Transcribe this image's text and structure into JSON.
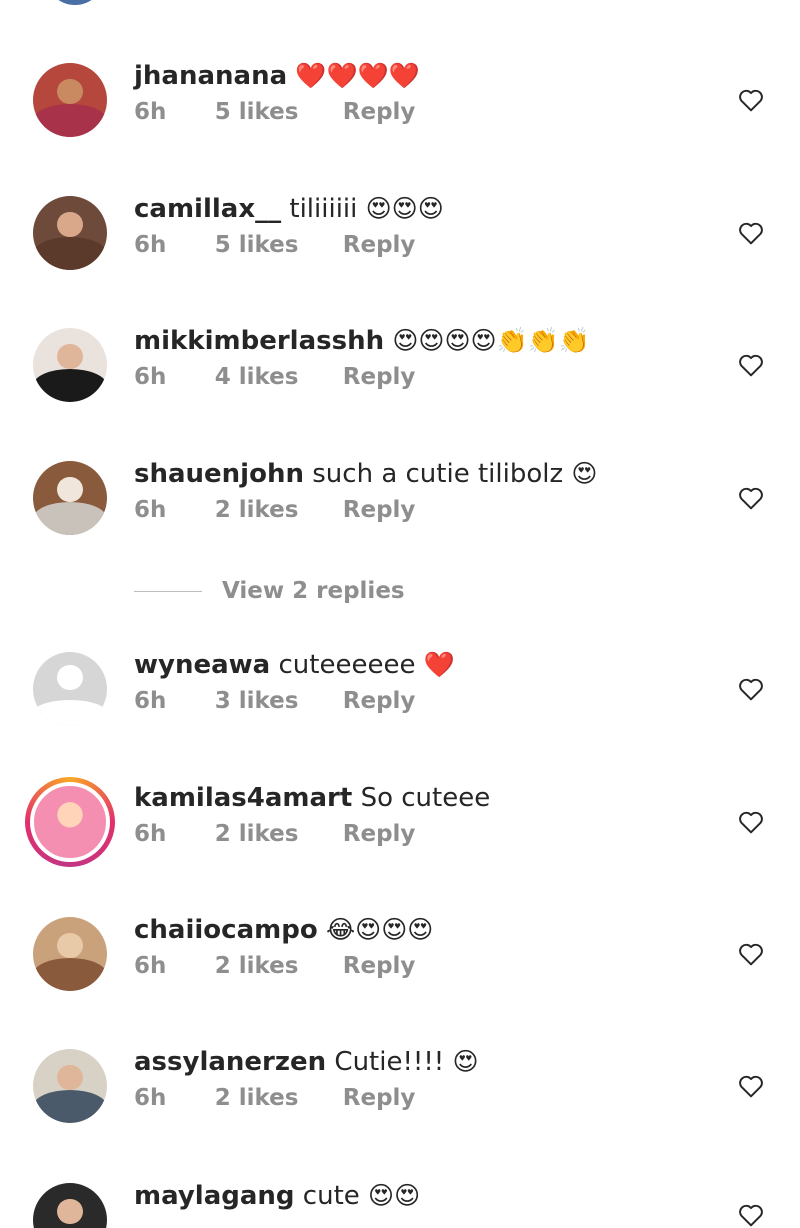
{
  "comments": [
    {
      "username": "jhananana",
      "text": "",
      "emoji": "❤️❤️❤️❤️",
      "time": "6h",
      "likes": "5 likes",
      "reply": "Reply",
      "avatar": {
        "bg": "#b5473c",
        "skin": "#c98a62",
        "shirt": "#a8324a"
      }
    },
    {
      "username": "camillax__",
      "text": "tiliiiiii",
      "emoji": "😍😍😍",
      "time": "6h",
      "likes": "5 likes",
      "reply": "Reply",
      "avatar": {
        "bg": "#6e4a3a",
        "skin": "#d9a88a",
        "shirt": "#5b3a2c"
      }
    },
    {
      "username": "mikkimberlasshh",
      "text": "",
      "emoji": "😍😍😍😍👏👏👏",
      "time": "6h",
      "likes": "4 likes",
      "reply": "Reply",
      "avatar": {
        "bg": "#e9e2dd",
        "skin": "#e0b69a",
        "shirt": "#1a1a1a"
      }
    },
    {
      "username": "shauenjohn",
      "text": "such a cutie tilibolz",
      "emoji": "😍",
      "time": "6h",
      "likes": "2 likes",
      "reply": "Reply",
      "avatar": {
        "bg": "#8a5a3c",
        "skin": "#f0e6dc",
        "shirt": "#c9c2bb"
      }
    },
    {
      "username": "wyneawa",
      "text": "cuteeeeee",
      "emoji": "❤️",
      "time": "6h",
      "likes": "3 likes",
      "reply": "Reply",
      "avatar": {
        "bg": "#d6d6d6",
        "skin": "#ffffff",
        "shirt": "#ffffff"
      }
    },
    {
      "username": "kamilas4amart",
      "text": "So cuteee",
      "emoji": "",
      "time": "6h",
      "likes": "2 likes",
      "reply": "Reply",
      "avatar": {
        "bg": "#f48fb1",
        "skin": "#ffd4b8",
        "shirt": "#ffffff"
      }
    },
    {
      "username": "chaiiocampo",
      "text": "",
      "emoji": "😂😍😍😍",
      "time": "6h",
      "likes": "2 likes",
      "reply": "Reply",
      "avatar": {
        "bg": "#c9a27c",
        "skin": "#e8c9a8",
        "shirt": "#8a5a3c"
      }
    },
    {
      "username": "assylanerzen",
      "text": "Cutie!!!!",
      "emoji": "😍",
      "time": "6h",
      "likes": "2 likes",
      "reply": "Reply",
      "avatar": {
        "bg": "#d8d2c6",
        "skin": "#e0b69a",
        "shirt": "#4a5a6a"
      }
    },
    {
      "username": "maylagang",
      "text": "cute",
      "emoji": "😍😍",
      "time": "",
      "likes": "",
      "reply": "",
      "avatar": {
        "bg": "#2a2a2a",
        "skin": "#e0b69a",
        "shirt": "#2a2a2a"
      }
    }
  ],
  "view_replies": "View 2 replies",
  "icons": {
    "like": "heart-outline-icon"
  },
  "colors": {
    "text": "#262626",
    "muted": "#8e8e8e",
    "heart": "#262626"
  }
}
